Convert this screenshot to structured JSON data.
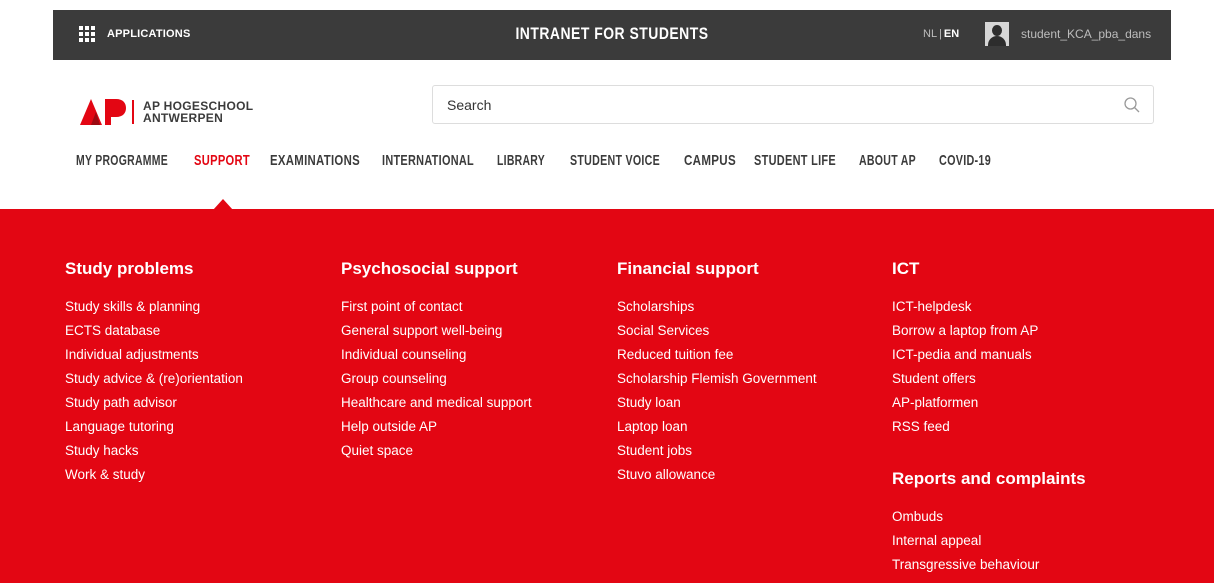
{
  "topbar": {
    "apps_label": "APPLICATIONS",
    "title": "INTRANET FOR STUDENTS",
    "lang_nl": "NL",
    "lang_separator": "|",
    "lang_en": "EN",
    "username": "student_KCA_pba_dans"
  },
  "header": {
    "logo_line1": "AP HOGESCHOOL",
    "logo_line2": "ANTWERPEN",
    "search_placeholder": "Search"
  },
  "nav": {
    "items": [
      "MY PROGRAMME",
      "SUPPORT",
      "EXAMINATIONS",
      "INTERNATIONAL",
      "LIBRARY",
      "STUDENT VOICE",
      "CAMPUS",
      "STUDENT LIFE",
      "ABOUT AP",
      "COVID-19"
    ],
    "active": "SUPPORT"
  },
  "menu": {
    "study_problems": {
      "heading": "Study problems",
      "links": [
        "Study skills & planning",
        "ECTS database",
        "Individual adjustments",
        "Study advice & (re)orientation",
        "Study path advisor",
        "Language tutoring",
        "Study hacks",
        "Work & study"
      ]
    },
    "psychosocial": {
      "heading": "Psychosocial support",
      "links": [
        "First point of contact",
        "General support well-being",
        "Individual counseling",
        "Group counseling",
        "Healthcare and medical support",
        "Help outside AP",
        "Quiet space"
      ]
    },
    "financial": {
      "heading": "Financial support",
      "links": [
        "Scholarships",
        "Social Services",
        "Reduced tuition fee",
        "Scholarship Flemish Government",
        "Study loan",
        "Laptop loan",
        "Student jobs",
        "Stuvo allowance"
      ]
    },
    "ict": {
      "heading": "ICT",
      "links": [
        "ICT-helpdesk",
        "Borrow a laptop from AP",
        "ICT-pedia and manuals",
        "Student offers",
        "AP-platformen",
        "RSS feed"
      ]
    },
    "reports": {
      "heading": "Reports and complaints",
      "links": [
        "Ombuds",
        "Internal appeal",
        "Transgressive behaviour"
      ]
    }
  },
  "colors": {
    "brand_red": "#e30613",
    "topbar": "#3b3b3b",
    "nav_text": "#3b3b3b"
  },
  "icons": [
    "apps-grid-icon",
    "user-avatar-icon",
    "search-icon",
    "ap-logo"
  ]
}
